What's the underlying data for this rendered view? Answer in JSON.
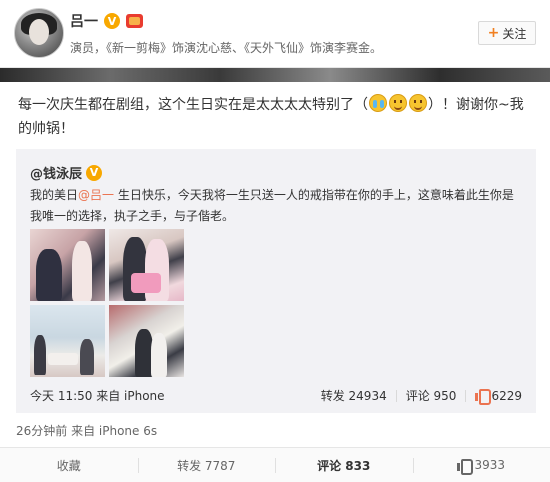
{
  "header": {
    "user_name": "吕一",
    "verified_badge": "V",
    "description": "演员，《新一剪梅》饰演沈心慈、《天外飞仙》饰演李赛金。",
    "follow_label": "关注",
    "follow_plus": "+"
  },
  "post": {
    "text_before": "每一次庆生都在剧组，这个生日实在是太太太太特别了（",
    "text_after": "）！谢谢你~我的帅锅！",
    "emoticons": [
      "cry-emoji",
      "smile-emoji",
      "smile-emoji"
    ],
    "meta": "26分钟前 来自 iPhone 6s"
  },
  "retweet": {
    "author": "@钱泳辰",
    "verified_badge": "V",
    "text_before": "我的美日",
    "mention": "@吕一",
    "text_after": " 生日快乐，今天我将一生只送一人的戒指带在你的手上，这意味着此生你是我唯一的选择，执子之手，与子偕老。",
    "meta": "今天 11:50 来自 iPhone",
    "repost_label": "转发 24934",
    "comment_label": "评论 950",
    "like_count": "6229"
  },
  "actions": {
    "favorite": "收藏",
    "repost": "转发 7787",
    "comment": "评论 833",
    "like": "3933"
  },
  "colors": {
    "accent": "#eb7350",
    "verified": "#f8a800"
  }
}
